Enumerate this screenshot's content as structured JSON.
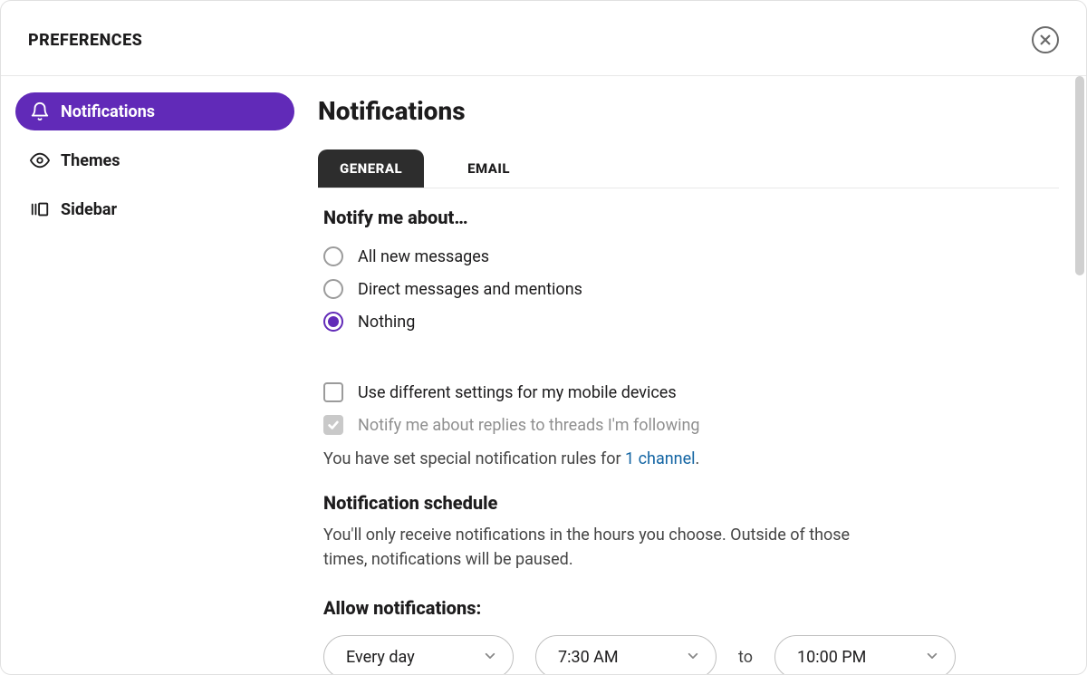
{
  "modal": {
    "title": "PREFERENCES"
  },
  "sidebar": {
    "items": [
      {
        "label": "Notifications",
        "active": true
      },
      {
        "label": "Themes",
        "active": false
      },
      {
        "label": "Sidebar",
        "active": false
      }
    ]
  },
  "page": {
    "title": "Notifications"
  },
  "tabs": [
    {
      "label": "GENERAL",
      "active": true
    },
    {
      "label": "EMAIL",
      "active": false
    }
  ],
  "notify_section": {
    "heading": "Notify me about…",
    "options": [
      {
        "label": "All new messages",
        "selected": false
      },
      {
        "label": "Direct messages and mentions",
        "selected": false
      },
      {
        "label": "Nothing",
        "selected": true
      }
    ],
    "mobile_checkbox": {
      "label": "Use different settings for my mobile devices",
      "checked": false,
      "disabled": false
    },
    "threads_checkbox": {
      "label": "Notify me about replies to threads I'm following",
      "checked": true,
      "disabled": true
    },
    "special_rules_prefix": "You have set special notification rules for ",
    "special_rules_link": "1 channel",
    "special_rules_suffix": "."
  },
  "schedule_section": {
    "heading": "Notification schedule",
    "description": "You'll only receive notifications in the hours you choose. Outside of those times, notifications will be paused."
  },
  "allow_section": {
    "heading": "Allow notifications:",
    "frequency": "Every day",
    "start_time": "7:30 AM",
    "to_label": "to",
    "end_time": "10:00 PM"
  }
}
